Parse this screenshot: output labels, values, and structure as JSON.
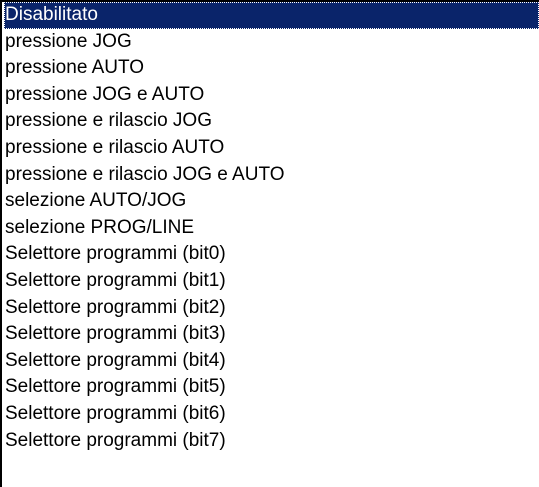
{
  "listbox": {
    "selected_index": 0,
    "colors": {
      "selection_background": "#0a246a",
      "selection_text": "#ffffff",
      "text": "#000000",
      "background": "#ffffff"
    },
    "items": [
      {
        "label": "Disabilitato"
      },
      {
        "label": "pressione JOG"
      },
      {
        "label": "pressione AUTO"
      },
      {
        "label": "pressione JOG e AUTO"
      },
      {
        "label": "pressione e rilascio JOG"
      },
      {
        "label": "pressione e rilascio AUTO"
      },
      {
        "label": "pressione e rilascio JOG e AUTO"
      },
      {
        "label": "selezione AUTO/JOG"
      },
      {
        "label": "selezione PROG/LINE"
      },
      {
        "label": "Selettore programmi (bit0)"
      },
      {
        "label": "Selettore programmi (bit1)"
      },
      {
        "label": "Selettore programmi (bit2)"
      },
      {
        "label": "Selettore programmi (bit3)"
      },
      {
        "label": "Selettore programmi (bit4)"
      },
      {
        "label": "Selettore programmi (bit5)"
      },
      {
        "label": "Selettore programmi (bit6)"
      },
      {
        "label": "Selettore programmi (bit7)"
      }
    ]
  }
}
